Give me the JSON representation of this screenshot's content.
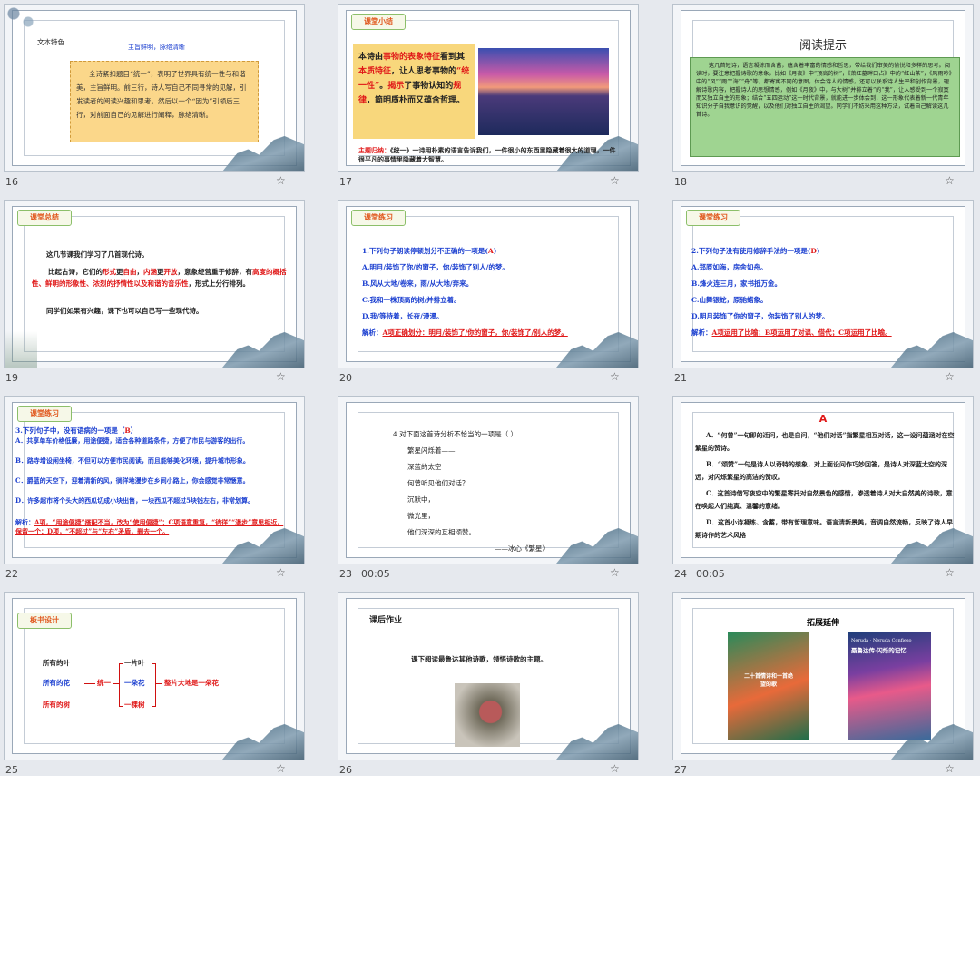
{
  "slides": [
    {
      "num": "16",
      "star": "☆",
      "label": "文本特色",
      "sub": "主旨鲜明，脉络清晰",
      "body": "全诗紧扣题目“统一”，表明了世界具有统一性与和谐美，主旨鲜明。前三行，诗人写自己不同寻常的见解，引发读者的阅读兴趣和思考。然后以一个“因为”引领后三行，对前面自己的见解进行阐释，脉络清晰。"
    },
    {
      "num": "17",
      "star": "☆",
      "tag": "课堂小结",
      "l1": "本诗由",
      "h1": "事物的表象特征",
      "l2": "看到其",
      "h2": "本质特征",
      "l3": "，让人思考事物的",
      "h3": "“统一性”",
      "l4": "。",
      "h4": "揭示",
      "l5": "了事物认知的",
      "h5": "规律",
      "l6": "，简明质朴而又蕴含哲理。",
      "theme_label": "主题归纳：",
      "theme": "《统一》一诗用朴素的语言告诉我们，一件很小的东西里隐藏着很大的道理，一件很平凡的事情里隐藏着大智慧。"
    },
    {
      "num": "18",
      "star": "☆",
      "title": "阅读提示",
      "body": "这几首短诗，语言凝练而含蓄，蕴含着丰富的情感和哲思，带给我们审美的愉悦和多样的思考。阅读时，要注意把握诗歌的意象，比如《月夜》中“顶高的树”，《萧红墓畔口占》中的“红山茶”，《风雨吟》中的“风”“雨”“海”“舟”等，都寄寓不同的意图。体会诗人的情感，还可以联系诗人生平和创作背景，理解诗歌内容，把握诗人的思想情感，例如《月夜》中，与大树“并排立着”的“我”，让人感受到一个寂寞而又独立自主的形象；结合“五四运动”这一时代背景，就能进一步体会到，这一形象代表着新一代青年知识分子自我意识的觉醒，以及他们对独立自主的渴望。同学们不妨采用这种方法，试着自己解读这几首诗。"
    },
    {
      "num": "19",
      "star": "☆",
      "tag": "课堂总结",
      "p1": "这几节课我们学习了几首现代诗。",
      "p2a": "比起古诗，它们的",
      "p2b": "形式",
      "p2c": "更",
      "p2d": "自由",
      "p2e": "，",
      "p2f": "内涵",
      "p2g": "更",
      "p2h": "开放",
      "p2i": "，意象经营重于修辞，有",
      "p2j": "高度的概括性、鲜明的形象性、浓烈的抒情性以及和谐的音乐性",
      "p2k": "，形式上分行排列。",
      "p3": "同学们如果有兴趣，课下也可以自己写一些现代诗。"
    },
    {
      "num": "20",
      "star": "☆",
      "tag": "课堂练习",
      "q": "1.下列句子朗读停顿划分不正确的一项是(",
      "ans": "A",
      "q_end": ")",
      "opts": [
        "A.明月/装饰了你/的窗子，你/装饰了别人/的梦。",
        "B.风从大地/卷来，雨/从大地/奔来。",
        "C.我和一株顶高的树/并排立着。",
        "D.我/等待着，长夜/漫漫。"
      ],
      "analysis_label": "解析：",
      "analysis": "A项正确划分：明月/装饰了/你的窗子，你/装饰了/别人的梦。"
    },
    {
      "num": "21",
      "star": "☆",
      "tag": "课堂练习",
      "q": "2.下列句子没有使用修辞手法的一项是(",
      "ans": "D",
      "q_end": ")",
      "opts": [
        "A.郑原如海，房舍如舟。",
        "B.烽火连三月，家书抵万金。",
        "C.山舞银蛇，原驰蜡象。",
        "D.明月装饰了你的窗子，你装饰了别人的梦。"
      ],
      "analysis_label": "解析：",
      "analysis": "A项运用了比喻；B项运用了对讽、借代；C项运用了比喻。"
    },
    {
      "num": "22",
      "star": "☆",
      "tag": "课堂练习",
      "q": "3.下列句子中，没有语病的一项是（",
      "ans": "B",
      "q_end": "）",
      "opts": [
        "A．共享单车价格低廉，用途便捷，适合各种道路条件，方便了市民与游客的出行。",
        "B．路寺增设闲坐椅，不但可以方便市民阅读，而且能够美化环境，提升城市形象。",
        "C．爵蓝的天空下，迎着清新的风，徜徉地漫步在乡间小路上，你会感觉非常惬意。",
        "D．许多超市将个头大的西瓜切成小块出售，一块西瓜不超过5块钱左右，非常划算。"
      ],
      "analysis_label": "解析：",
      "analysis": "A项，“用途便捷”搭配不当，改为“使用便捷”；C项语意重复，“徜徉”“漫步”意思相近，保留一个；D项，“不超过”与“左右”矛盾，删去一个。"
    },
    {
      "num": "23",
      "time": "00:05",
      "star": "☆",
      "q": "4.对下面这首诗分析不恰当的一项是（  ）",
      "poem": [
        "繁星闪烁着——",
        "深蓝的太空",
        "何曾听见他们对话？",
        "沉默中，",
        "微光里，",
        "他们深深的互相颂赞。"
      ],
      "author": "——冰心《繁星》"
    },
    {
      "num": "24",
      "time": "00:05",
      "star": "☆",
      "ans": "A",
      "items": [
        "A．“何曾”一句即的迁问，也是自问，“他们对话”指繁星相互对话，这一设问蕴涵对在空繁星的赞诗。",
        "B．“颂赞”一句是诗人以奇特的想象，对上面设问作巧妙回答，是诗人对深蓝太空的深远，对闪烁繁星的高洁的赞叹。",
        "C．这首诗借写夜空中的繁星寄托对自然景色的感情，渗透着诗人对大自然美的诗歌，意在唤起人们纯真、温馨的意绪。",
        "D．这首小诗凝练、含蓄，带有哲理意味。语言清新景美，音调自然流畅，反映了诗人早期诗作的艺术风格"
      ]
    },
    {
      "num": "25",
      "star": "☆",
      "tag": "板书设计",
      "left": [
        "所有的叶",
        "所有的花",
        "所有的树"
      ],
      "mid": "统一",
      "right": [
        "一片叶",
        "一朵花",
        "一棵树"
      ],
      "result": "整片大地是一朵花"
    },
    {
      "num": "26",
      "star": "☆",
      "title": "课后作业",
      "body": "课下阅读最鲁达其他诗歌，领悟诗歌的主题。"
    },
    {
      "num": "27",
      "star": "☆",
      "title": "拓展延伸",
      "book1": "二十首情诗和一首绝望的歌",
      "book2_top": "Neruda · Neruda Confieso",
      "book2": "聂鲁达传·闪烁的记忆"
    }
  ],
  "colors": {
    "red": "#e01818",
    "blue": "#1b3fd0",
    "orange": "#e05a10",
    "accent": "#8cbf6a"
  }
}
